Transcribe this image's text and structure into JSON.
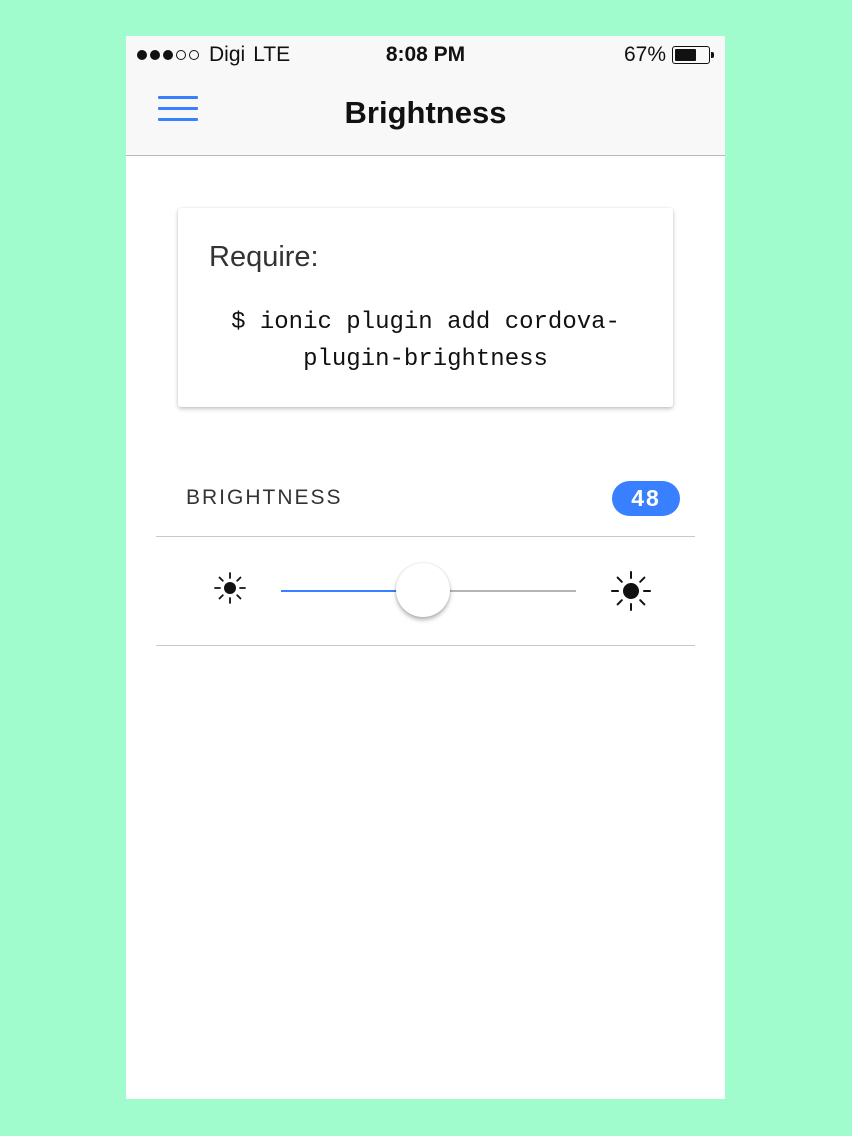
{
  "status_bar": {
    "carrier": "Digi",
    "network": "LTE",
    "time": "8:08 PM",
    "battery_text": "67%",
    "battery_level": 0.67,
    "signal_bars_filled": 3,
    "signal_bars_total": 5
  },
  "navbar": {
    "title": "Brightness",
    "menu_icon": "hamburger-menu-icon"
  },
  "card": {
    "title": "Require:",
    "code_line1": "$ ionic plugin add cordova-",
    "code_line2": "plugin-brightness"
  },
  "brightness": {
    "label": "BRIGHTNESS",
    "value": 48,
    "value_text": "48",
    "min": 0,
    "max": 100,
    "icon_min": "sun-small-icon",
    "icon_max": "sun-large-icon"
  },
  "colors": {
    "accent": "#3880ff",
    "backdrop": "#a0fccd"
  }
}
